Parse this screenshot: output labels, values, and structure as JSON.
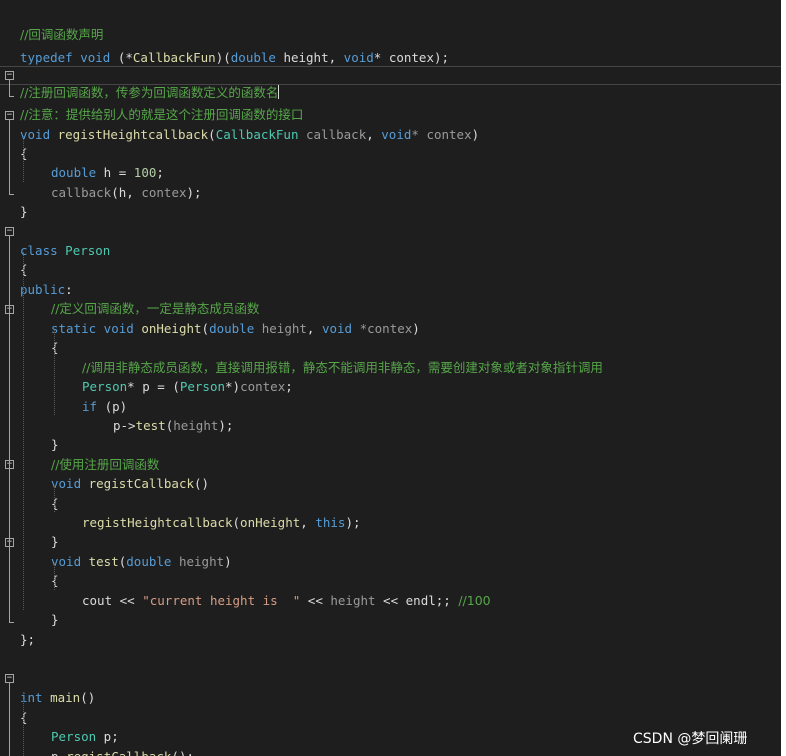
{
  "lines": {
    "l1": {
      "comment": "//回调函数声明"
    },
    "l2": {
      "kw1": "typedef",
      "kw2": "void",
      "p1": " (*",
      "fn": "CallbackFun",
      "p2": ")(",
      "kw3": "double",
      "v1": " height",
      "p3": ", ",
      "kw4": "void",
      "v2": "* contex",
      "p4": ");"
    },
    "l3": {
      "comment": "//注册回调函数，传参为回调函数定义的函数名"
    },
    "l4": {
      "comment": "//注意：提供给别人的就是这个注册回调函数的接口"
    },
    "l5": {
      "kw1": "void",
      "fn": " registHeightcallback",
      "p1": "(",
      "ty": "CallbackFun",
      "pa1": " callback",
      "p2": ", ",
      "kw2": "void",
      "pa2": "* contex",
      "p3": ")"
    },
    "l6": {
      "text": "{"
    },
    "l7": {
      "kw1": "double",
      "v1": " h",
      "p1": " = ",
      "nm": "100",
      "p2": ";"
    },
    "l8": {
      "pa1": "callback",
      "p1": "(",
      "v1": "h",
      "p2": ", ",
      "pa2": "contex",
      "p3": ");"
    },
    "l9": {
      "text": "}"
    },
    "l10": {
      "kw1": "class",
      "ty": " Person"
    },
    "l11": {
      "text": "{"
    },
    "l12": {
      "kw1": "public",
      "p1": ":"
    },
    "l13": {
      "comment": "//定义回调函数，一定是静态成员函数"
    },
    "l14": {
      "kw1": "static",
      "kw2": " void",
      "fn": " onHeight",
      "p1": "(",
      "kw3": "double",
      "pa1": " height",
      "p2": ", ",
      "kw4": "void",
      "pa2": " *contex",
      "p3": ")"
    },
    "l15": {
      "text": "{"
    },
    "l16": {
      "comment": "//调用非静态成员函数，直接调用报错，静态不能调用非静态，需要创建对象或者对象指针调用"
    },
    "l17": {
      "ty1": "Person",
      "p1": "* ",
      "v1": "p",
      "p2": " = (",
      "ty2": "Person",
      "p3": "*)",
      "pa1": "contex",
      "p4": ";"
    },
    "l18": {
      "kw1": "if",
      "p1": " (",
      "v1": "p",
      "p2": ")"
    },
    "l19": {
      "v1": "p",
      "p1": "->",
      "fn": "test",
      "p2": "(",
      "pa1": "height",
      "p3": ");"
    },
    "l20": {
      "text": "}"
    },
    "l21": {
      "comment": "//使用注册回调函数"
    },
    "l22": {
      "kw1": "void",
      "fn": " registCallback",
      "p1": "()"
    },
    "l23": {
      "text": "{"
    },
    "l24": {
      "fn": "registHeightcallback",
      "p1": "(",
      "fn2": "onHeight",
      "p2": ", ",
      "kw1": "this",
      "p3": ");"
    },
    "l25": {
      "text": "}"
    },
    "l26": {
      "kw1": "void",
      "fn": " test",
      "p1": "(",
      "kw2": "double",
      "pa1": " height",
      "p2": ")"
    },
    "l27": {
      "text": "{"
    },
    "l28": {
      "v1": "cout",
      "p1": " << ",
      "st": "\"current height is  \"",
      "p2": " << ",
      "pa1": "height",
      "p3": " << ",
      "v2": "endl",
      "p4": ";; ",
      "cm": "//100"
    },
    "l29": {
      "text": "}"
    },
    "l30": {
      "text": "};"
    },
    "l31": {
      "kw1": "int",
      "fn": " main",
      "p1": "()"
    },
    "l32": {
      "text": "{"
    },
    "l33": {
      "ty": "Person",
      "v1": " p",
      "p1": ";"
    },
    "l34": {
      "v1": "p",
      "p1": ".",
      "fn": "registCallback",
      "p2": "();"
    }
  },
  "watermark": "CSDN @梦回阑珊",
  "colors": {
    "background": "#1e1e1e",
    "keyword": "#569cd6",
    "type": "#4ec9b0",
    "function": "#dcdcaa",
    "comment": "#57a64a",
    "string": "#d69d85",
    "number": "#b5cea8",
    "parameter": "#9a9a9a"
  }
}
